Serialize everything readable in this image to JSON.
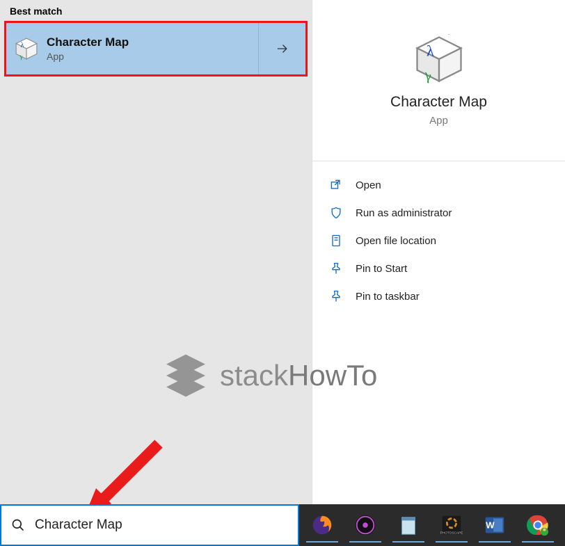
{
  "section_header": "Best match",
  "result": {
    "title": "Character Map",
    "subtitle": "App"
  },
  "preview": {
    "title": "Character Map",
    "subtitle": "App"
  },
  "actions": [
    {
      "label": "Open"
    },
    {
      "label": "Run as administrator"
    },
    {
      "label": "Open file location"
    },
    {
      "label": "Pin to Start"
    },
    {
      "label": "Pin to taskbar"
    }
  ],
  "watermark": {
    "part1": "stack",
    "part2": "HowTo"
  },
  "search": {
    "value": "Character Map"
  }
}
